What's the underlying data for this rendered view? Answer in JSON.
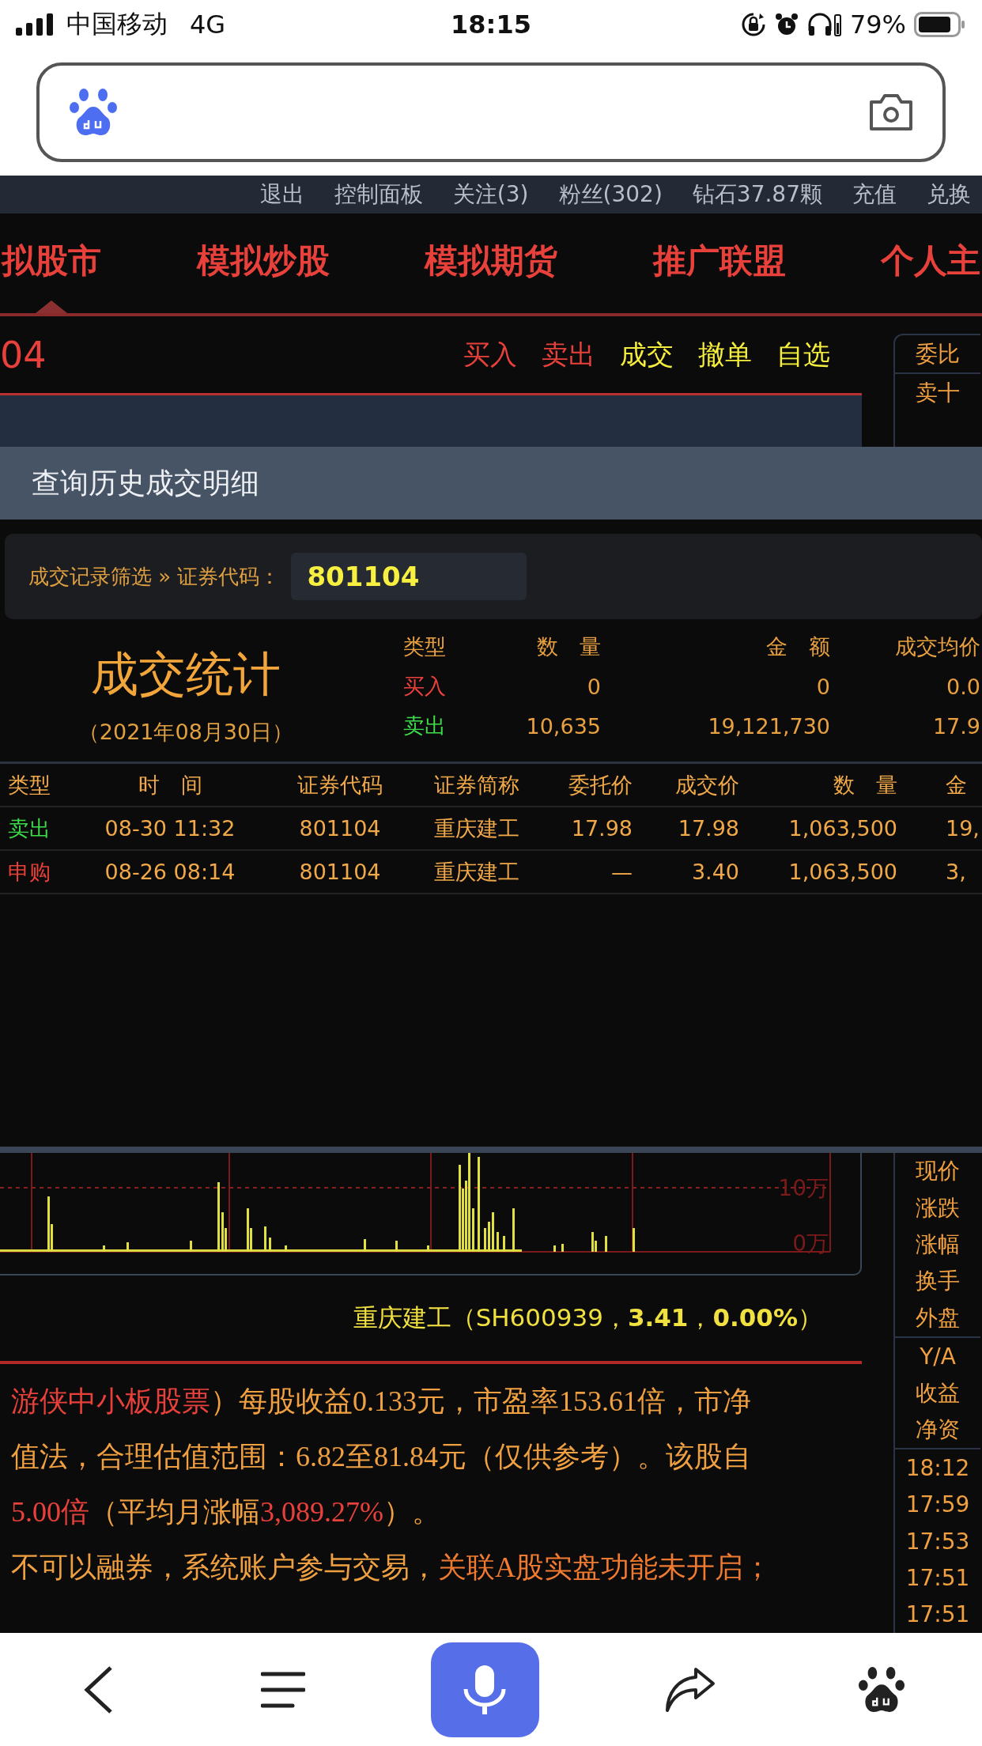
{
  "status_bar": {
    "carrier": "中国移动",
    "network": "4G",
    "time": "18:15",
    "battery": "79%"
  },
  "top_links": [
    "退出",
    "控制面板",
    "关注(3)",
    "粉丝(302)",
    "钻石37.87颗",
    "充值",
    "兑换"
  ],
  "nav_tabs": [
    {
      "label": "拟股市",
      "selected": true
    },
    {
      "label": "模拟炒股",
      "selected": false
    },
    {
      "label": "模拟期货",
      "selected": false
    },
    {
      "label": "推广联盟",
      "selected": false
    },
    {
      "label": "个人主",
      "selected": false
    }
  ],
  "trade_panel": {
    "code_fragment": "04",
    "actions": [
      {
        "label": "买入",
        "color": "#e8403a"
      },
      {
        "label": "卖出",
        "color": "#e8403a"
      },
      {
        "label": "成交",
        "color": "#f5ee3c"
      },
      {
        "label": "撤单",
        "color": "#f5ee3c"
      },
      {
        "label": "自选",
        "color": "#f5ee3c"
      }
    ]
  },
  "side_panel_top": [
    "委比",
    "卖十"
  ],
  "dialog": {
    "title": "查询历史成交明细",
    "filter_label": "成交记录筛选 » 证券代码：",
    "code_value": "801104",
    "stats": {
      "title": "成交统计",
      "date": "（2021年08月30日）",
      "columns": [
        "类型",
        "数　量",
        "金　额",
        "成交均价"
      ],
      "rows": [
        {
          "color": "#e8403a",
          "cells": [
            "买入",
            "0",
            "0",
            "0.0"
          ]
        },
        {
          "color": "#3ddc4a",
          "cells": [
            "卖出",
            "10,635",
            "19,121,730",
            "17.9"
          ]
        }
      ]
    },
    "table": {
      "columns": [
        "类型",
        "时　间",
        "证券代码",
        "证券简称",
        "委托价",
        "成交价",
        "数　量",
        "金"
      ],
      "rows": [
        {
          "color": "#3ddc4a",
          "cells": [
            "卖出",
            "08-30 11:32",
            "801104",
            "重庆建工",
            "17.98",
            "17.98",
            "1,063,500",
            "19,"
          ]
        },
        {
          "color": "#e8403a",
          "cells": [
            "申购",
            "08-26 08:14",
            "801104",
            "重庆建工",
            "—",
            "3.40",
            "1,063,500",
            "3,"
          ]
        }
      ]
    }
  },
  "volume_chart": {
    "axis_labels": [
      "10万",
      "0万"
    ]
  },
  "stock_line": "重庆建工（SH600939，**3.41**，**0.00%**）",
  "paragraph": {
    "lines": [
      {
        "segments": [
          {
            "text": "游侠中小板股票",
            "color": "#e8403a"
          },
          {
            "text": "）每股收益0.133元，市盈率153.61倍，市净",
            "color": "#f0a040"
          }
        ]
      },
      {
        "segments": [
          {
            "text": "值法，合理估值范围：6.82至81.84元（仅供参考）。该股自",
            "color": "#f0a040"
          }
        ]
      },
      {
        "segments": [
          {
            "text": "5.00倍",
            "color": "#e8403a"
          },
          {
            "text": "（平均月涨幅",
            "color": "#f0a040"
          },
          {
            "text": "3,089.27%",
            "color": "#e8403a"
          },
          {
            "text": "）。",
            "color": "#f0a040"
          }
        ]
      },
      {
        "segments": [
          {
            "text": "不可以融券，系统账户参与交易，",
            "color": "#f0a040"
          },
          {
            "text": "关联A股实盘功能未开启；",
            "color": "#f07a30"
          }
        ]
      }
    ]
  },
  "side_panel_bottom": {
    "quote_labels": [
      "现价",
      "涨跌",
      "涨幅",
      "换手",
      "外盘"
    ],
    "finance_labels": [
      "Y/A",
      "收益",
      "净资"
    ],
    "times": [
      "18:12",
      "17:59",
      "17:53",
      "17:51",
      "17:51"
    ]
  }
}
